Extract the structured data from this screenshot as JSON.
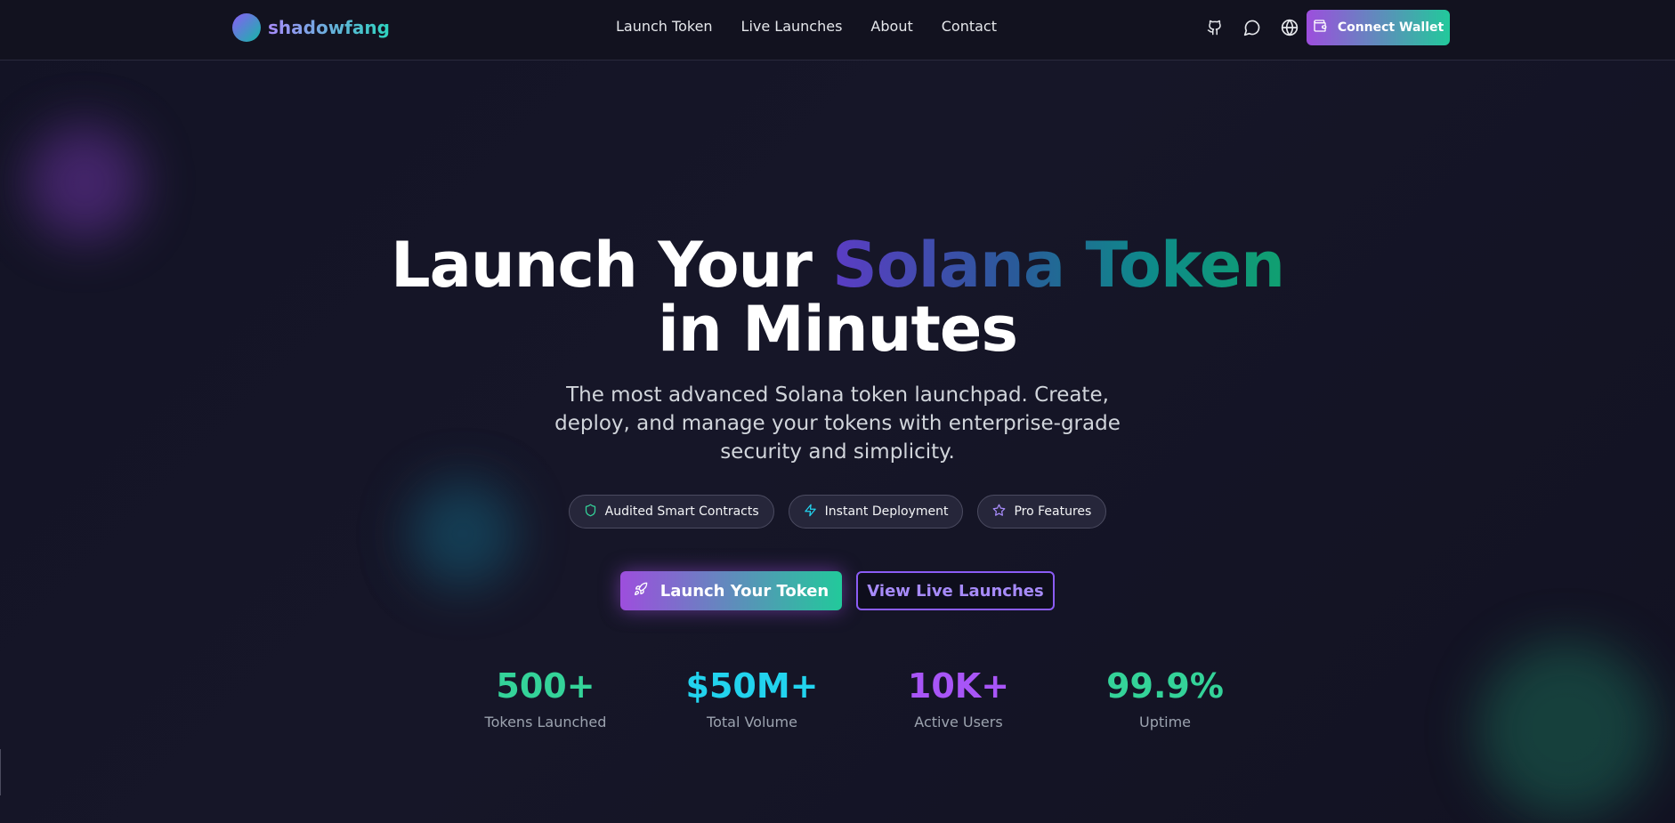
{
  "brand": {
    "name": "shadowfang"
  },
  "nav": {
    "links": [
      {
        "label": "Launch Token"
      },
      {
        "label": "Live Launches"
      },
      {
        "label": "About"
      },
      {
        "label": "Contact"
      }
    ],
    "icons": [
      "github-icon",
      "chat-icon",
      "globe-icon"
    ],
    "connect_label": "Connect Wallet"
  },
  "hero": {
    "title_line1_plain": "Launch Your ",
    "title_line1_gradient": "Solana Token",
    "title_line2": "in Minutes",
    "subtitle": "The most advanced Solana token launchpad. Create, deploy, and manage your tokens with enterprise-grade security and simplicity.",
    "pills": [
      {
        "label": "Audited Smart Contracts",
        "icon": "shield-icon",
        "color": "#34d399"
      },
      {
        "label": "Instant Deployment",
        "icon": "lightning-icon",
        "color": "#22d3ee"
      },
      {
        "label": "Pro Features",
        "icon": "star-icon",
        "color": "#a78bfa"
      }
    ],
    "cta_primary": "Launch Your Token",
    "cta_secondary": "View Live Launches"
  },
  "stats": [
    {
      "value": "500+",
      "label": "Tokens Launched",
      "color": "#34d399"
    },
    {
      "value": "$50M+",
      "label": "Total Volume",
      "color": "#22d3ee"
    },
    {
      "value": "10K+",
      "label": "Active Users",
      "color": "#a855f7"
    },
    {
      "value": "99.9%",
      "label": "Uptime",
      "color": "#34d399"
    }
  ],
  "colors": {
    "background": "#12121f",
    "accent_purple": "#9d4edd",
    "accent_green": "#22c99b"
  }
}
